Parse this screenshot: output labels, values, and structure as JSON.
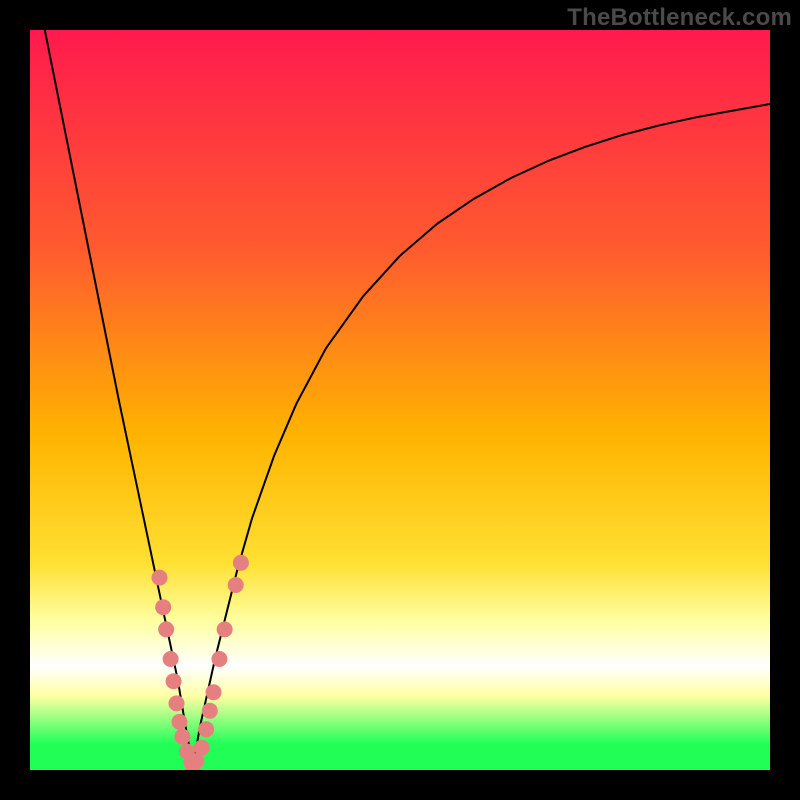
{
  "brand": "TheBottleneck.com",
  "colors": {
    "top": "#ff1a4d",
    "upper_mid": "#ff5c2e",
    "mid": "#ffb400",
    "lower_mid": "#ffe033",
    "pale_band": "#ffffa3",
    "white_band": "#ffffff",
    "green": "#21ff57",
    "black": "#000000",
    "dot": "#e68080"
  },
  "chart_data": {
    "type": "line",
    "title": "",
    "xlabel": "",
    "ylabel": "",
    "xlim": [
      0,
      100
    ],
    "ylim": [
      0,
      100
    ],
    "x_min_at": 22,
    "series": [
      {
        "name": "curve",
        "x": [
          0,
          2,
          4,
          6,
          8,
          10,
          12,
          14,
          16,
          18,
          19,
          20,
          21,
          22,
          23,
          24,
          25,
          26,
          28,
          30,
          33,
          36,
          40,
          45,
          50,
          55,
          60,
          65,
          70,
          75,
          80,
          85,
          90,
          95,
          100
        ],
        "values": [
          110,
          100,
          90,
          80,
          70,
          60,
          50,
          40.5,
          31,
          21.5,
          16.8,
          12,
          6,
          0.5,
          6,
          10.5,
          15,
          19,
          27,
          34,
          42.5,
          49.5,
          57,
          64,
          69.5,
          73.8,
          77.2,
          80,
          82.3,
          84.2,
          85.8,
          87.1,
          88.2,
          89.1,
          90
        ]
      }
    ],
    "dots": {
      "name": "markers",
      "points": [
        {
          "x": 17.5,
          "y": 26
        },
        {
          "x": 18.0,
          "y": 22
        },
        {
          "x": 18.4,
          "y": 19
        },
        {
          "x": 19.0,
          "y": 15
        },
        {
          "x": 19.4,
          "y": 12
        },
        {
          "x": 19.8,
          "y": 9
        },
        {
          "x": 20.2,
          "y": 6.5
        },
        {
          "x": 20.6,
          "y": 4.5
        },
        {
          "x": 21.2,
          "y": 2.5
        },
        {
          "x": 21.8,
          "y": 1
        },
        {
          "x": 22.0,
          "y": 0.5
        },
        {
          "x": 22.5,
          "y": 1.2
        },
        {
          "x": 23.2,
          "y": 3
        },
        {
          "x": 23.8,
          "y": 5.5
        },
        {
          "x": 24.3,
          "y": 8
        },
        {
          "x": 24.8,
          "y": 10.5
        },
        {
          "x": 25.6,
          "y": 15
        },
        {
          "x": 26.3,
          "y": 19
        },
        {
          "x": 27.8,
          "y": 25
        },
        {
          "x": 28.5,
          "y": 28
        }
      ]
    },
    "gradient_stops": [
      {
        "offset": 0.0,
        "color_key": "top"
      },
      {
        "offset": 0.3,
        "color_key": "upper_mid"
      },
      {
        "offset": 0.55,
        "color_key": "mid"
      },
      {
        "offset": 0.72,
        "color_key": "lower_mid"
      },
      {
        "offset": 0.8,
        "color_key": "pale_band"
      },
      {
        "offset": 0.86,
        "color_key": "white_band"
      },
      {
        "offset": 0.9,
        "color_key": "pale_band"
      },
      {
        "offset": 0.965,
        "color_key": "green"
      },
      {
        "offset": 1.0,
        "color_key": "green"
      }
    ]
  }
}
